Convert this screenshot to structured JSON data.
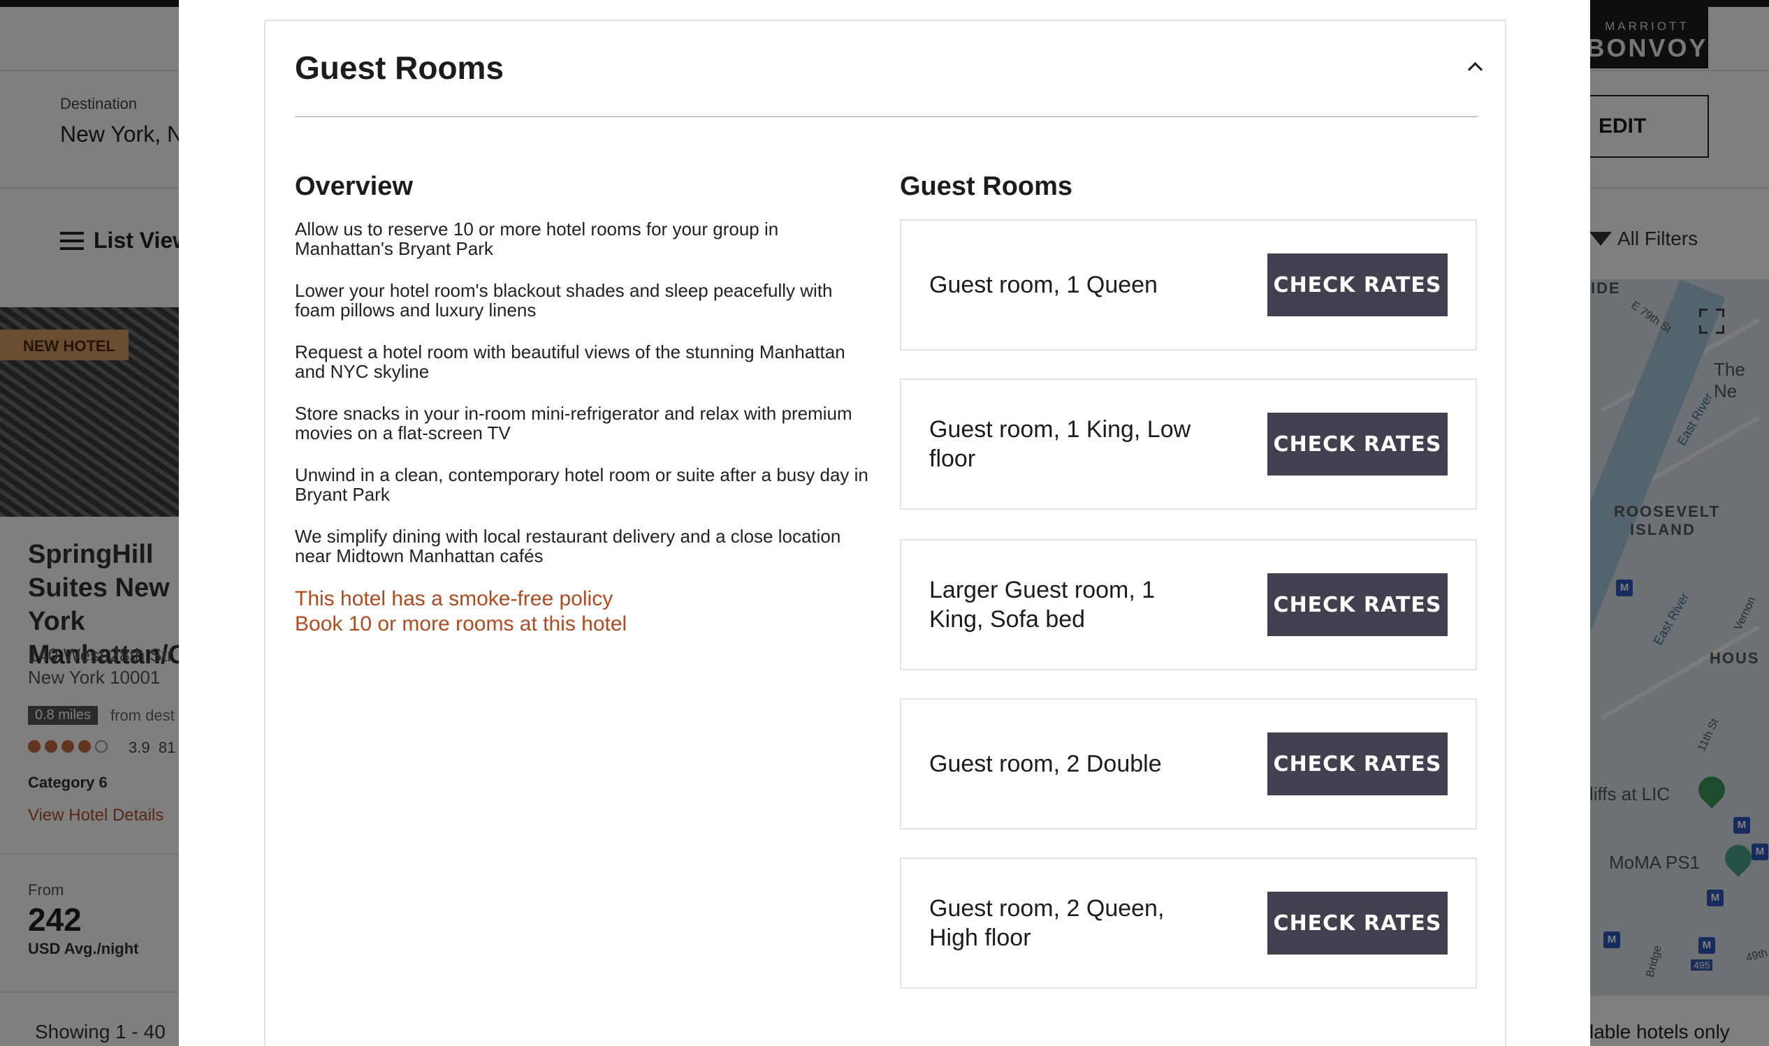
{
  "background": {
    "brand": {
      "top": "MARRIOTT",
      "bottom": "BONVOY"
    },
    "destination_label": "Destination",
    "destination_value": "New York, N",
    "edit_label": "EDIT",
    "list_view_label": "List View",
    "all_filters_label": "All Filters",
    "hotel": {
      "badge": "NEW HOTEL",
      "name": "SpringHill Suites New York Manhattan/C",
      "address_line1": "140 West 28th Str",
      "address_line2": "New York 10001",
      "distance": "0.8 miles",
      "distance_suffix": "from dest",
      "rating": "3.9",
      "reviews": "81",
      "category": "Category 6",
      "details_link": "View Hotel Details",
      "from_label": "From",
      "price": "242",
      "price_unit": "USD Avg./night"
    },
    "showing": "Showing 1 - 40",
    "available_only": "lable hotels only",
    "map_labels": [
      "IDE",
      "E 79th St",
      "The Ne",
      "East River",
      "ROOSEVELT ISLAND",
      "East River",
      "Vernon",
      "HOUS",
      "11th St",
      "liffs at LIC",
      "MoMA PS1",
      "Bridge",
      "495",
      "49th"
    ]
  },
  "modal": {
    "title": "Guest Rooms",
    "overview_title": "Overview",
    "overview_items": [
      "Allow us to reserve 10 or more hotel rooms for your group in Manhattan's Bryant Park",
      "Lower your hotel room's blackout shades and sleep peacefully with foam pillows and luxury linens",
      "Request a hotel room with beautiful views of the stunning Manhattan and NYC skyline",
      "Store snacks in your in-room mini-refrigerator and relax with premium movies on a flat-screen TV",
      "Unwind in a clean, contemporary hotel room or suite after a busy day in Bryant Park",
      "We simplify dining with local restaurant delivery and a close location near Midtown Manhattan cafés"
    ],
    "smoke_free": "This hotel has a smoke-free policy",
    "book_ten": "Book 10 or more rooms at this hotel",
    "rooms_title": "Guest Rooms",
    "rooms": [
      {
        "name": "Guest room, 1 Queen",
        "button": "CHECK RATES"
      },
      {
        "name": "Guest room, 1 King, Low floor",
        "button": "CHECK RATES"
      },
      {
        "name": "Larger Guest room, 1 King, Sofa bed",
        "button": "CHECK RATES"
      },
      {
        "name": "Guest room, 2 Double",
        "button": "CHECK RATES"
      },
      {
        "name": "Guest room, 2 Queen, High floor",
        "button": "CHECK RATES"
      }
    ]
  },
  "colors": {
    "button": "#42404f",
    "link": "#b34a1e",
    "scrim": "rgba(0,0,0,0.5)"
  }
}
